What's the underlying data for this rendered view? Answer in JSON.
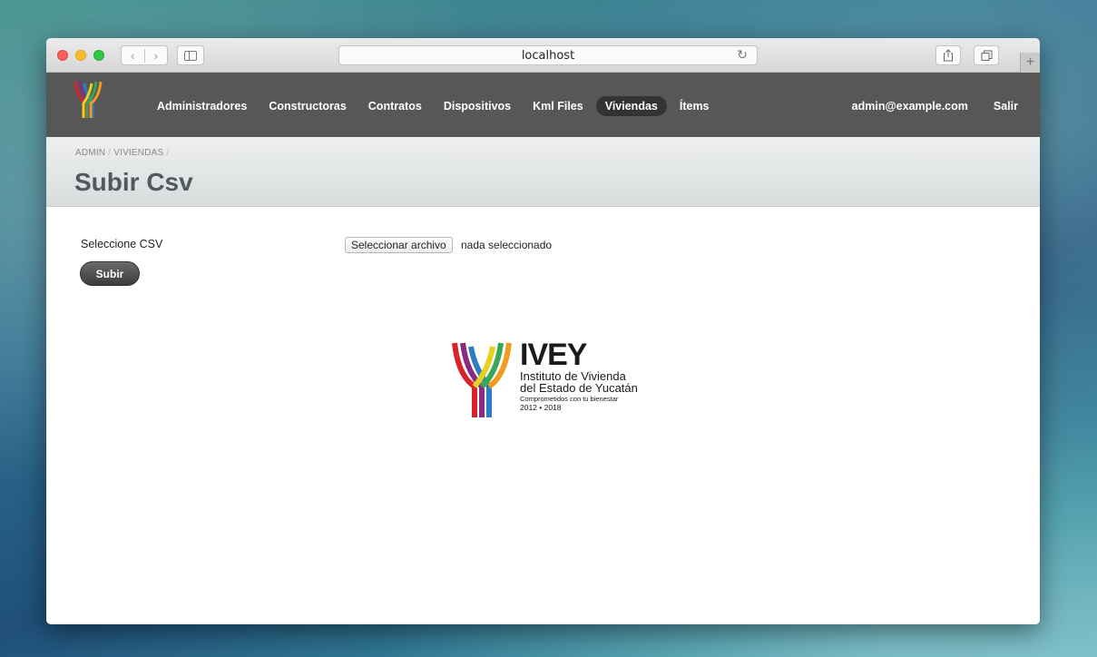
{
  "browser": {
    "url": "localhost",
    "back_icon": "chevron-left-icon",
    "forward_icon": "chevron-right-icon",
    "reload_icon": "reload-icon",
    "share_icon": "share-icon",
    "tabs_icon": "tabs-icon",
    "new_tab_label": "+"
  },
  "navbar": {
    "items": [
      {
        "label": "Administradores",
        "active": false
      },
      {
        "label": "Constructoras",
        "active": false
      },
      {
        "label": "Contratos",
        "active": false
      },
      {
        "label": "Dispositivos",
        "active": false
      },
      {
        "label": "Kml Files",
        "active": false
      },
      {
        "label": "Viviendas",
        "active": true
      },
      {
        "label": "Ítems",
        "active": false
      }
    ],
    "user_email": "admin@example.com",
    "logout_label": "Salir"
  },
  "header": {
    "breadcrumb": [
      "ADMIN",
      "VIVIENDAS"
    ],
    "title": "Subir Csv"
  },
  "form": {
    "field_label": "Seleccione CSV",
    "file_button_label": "Seleccionar archivo",
    "file_status": "nada seleccionado",
    "submit_label": "Subir"
  },
  "footer_logo": {
    "title": "IVEY",
    "line1": "Instituto de Vivienda",
    "line2": "del Estado de Yucatán",
    "line3": "Comprometidos con tu bienestar",
    "line4": "2012 • 2018"
  },
  "colors": {
    "navbar_bg": "#585757",
    "active_pill": "#333333",
    "title_color": "#4e5a60",
    "logo_red": "#d8232a",
    "logo_orange": "#f29b1d",
    "logo_green": "#3aa657",
    "logo_blue": "#2b7fc1",
    "logo_purple": "#8b2a83"
  }
}
